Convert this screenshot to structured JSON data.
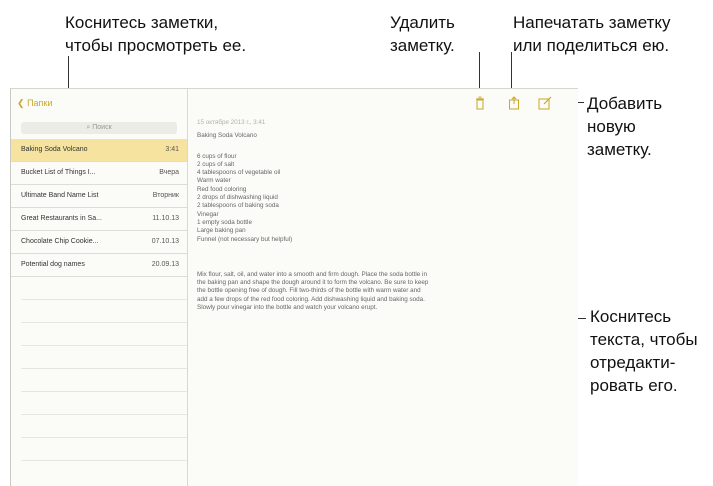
{
  "callouts": {
    "tap_note": [
      "Коснитесь заметки,",
      "чтобы просмотреть ее."
    ],
    "delete_note": [
      "Удалить",
      "заметку."
    ],
    "print_share": [
      "Напечатать заметку",
      "или поделиться ею."
    ],
    "add_note": [
      "Добавить",
      "новую",
      "заметку."
    ],
    "tap_text": [
      "Коснитесь",
      "текста, чтобы",
      "отредакти-",
      "ровать его."
    ]
  },
  "sidebar": {
    "back_label": "Папки",
    "search_placeholder": "Поиск",
    "notes": [
      {
        "title": "Baking Soda Volcano",
        "date": "3:41",
        "selected": true
      },
      {
        "title": "Bucket List of Things I...",
        "date": "Вчера",
        "selected": false
      },
      {
        "title": "Ultimate Band Name List",
        "date": "Вторник",
        "selected": false
      },
      {
        "title": "Great Restaurants in Sa...",
        "date": "11.10.13",
        "selected": false
      },
      {
        "title": "Chocolate Chip Cookie...",
        "date": "07.10.13",
        "selected": false
      },
      {
        "title": "Potential dog names",
        "date": "20.09.13",
        "selected": false
      }
    ]
  },
  "toolbar": {
    "icons": [
      "trash-icon",
      "share-icon",
      "compose-icon"
    ]
  },
  "note": {
    "date": "15 октября 2013 г., 3:41",
    "title": "Baking Soda Volcano",
    "ingredients": [
      "6 cups of flour",
      "2 cups of salt",
      "4 tablespoons of vegetable oil",
      "Warm water",
      "Red food coloring",
      "2 drops of dishwashing liquid",
      "2 tablespoons of baking soda",
      "Vinegar",
      "1 empty soda bottle",
      "Large baking pan",
      "Funnel (not necessary but helpful)"
    ],
    "paragraph": [
      "Mix flour, salt, oil, and water into a smooth and firm dough. Place the soda bottle in",
      "the baking pan and shape the dough around it to form the volcano. Be sure to keep",
      "the bottle opening free of dough. Fill two-thirds of the bottle with warm water and",
      "add a few drops of the red food coloring. Add dishwashing liquid and baking soda.",
      "Slowly pour vinegar into the bottle and watch your volcano erupt."
    ]
  }
}
